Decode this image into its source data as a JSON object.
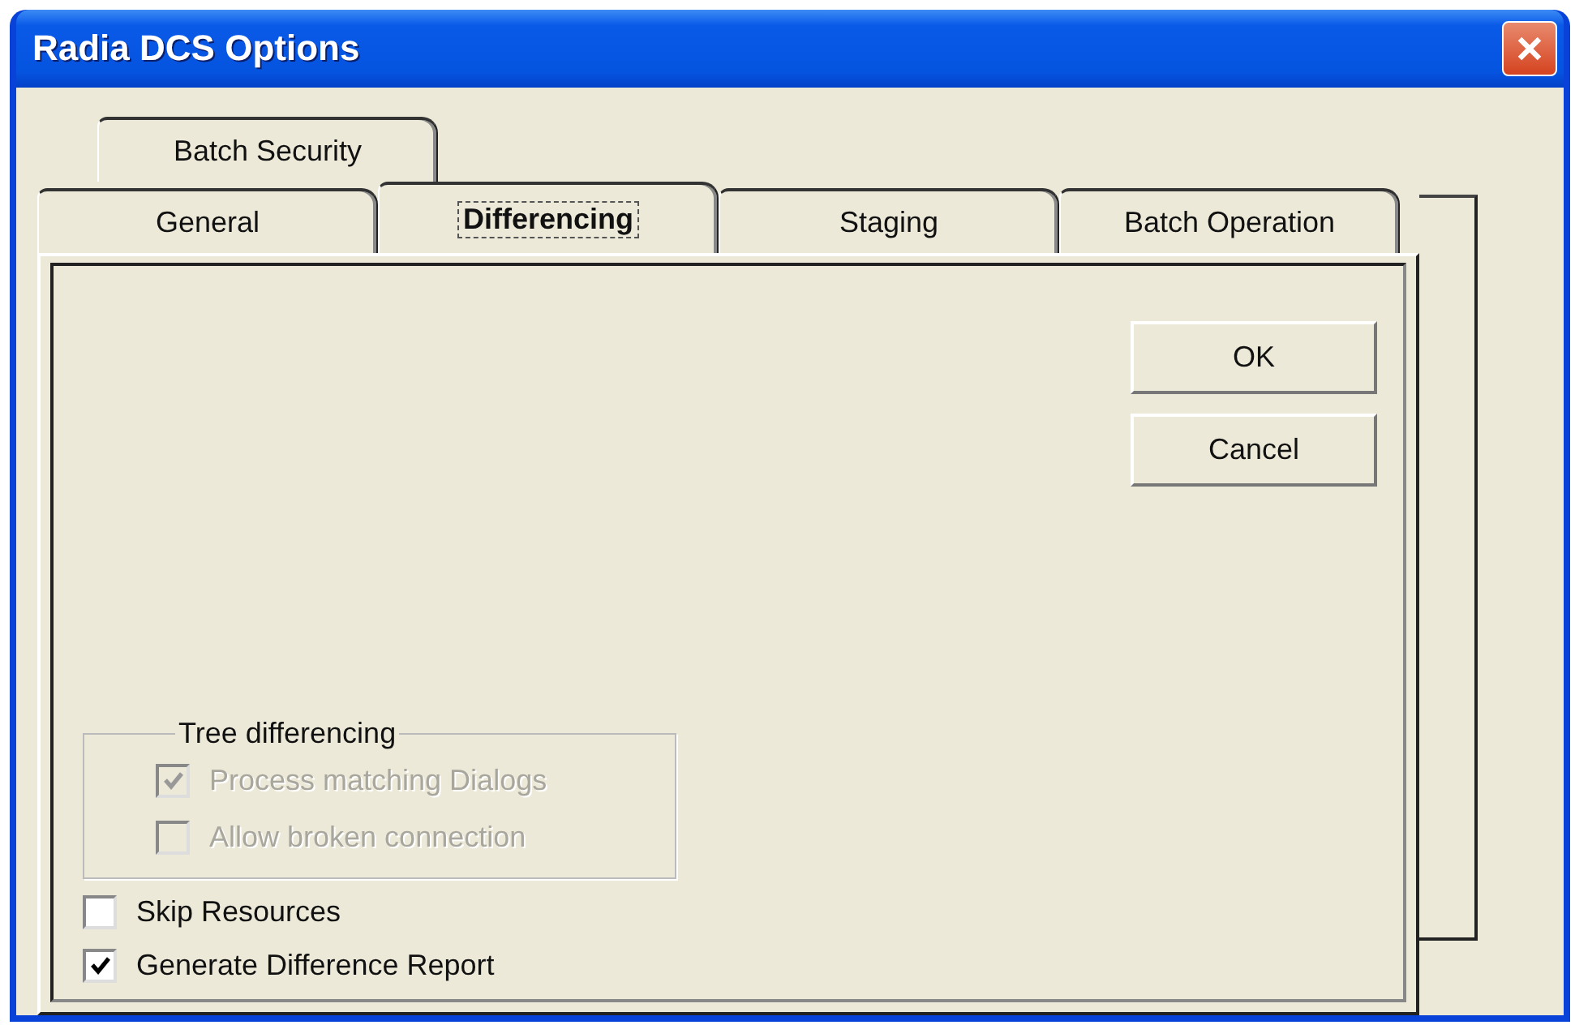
{
  "window": {
    "title": "Radia DCS Options"
  },
  "tab_rows": [
    [
      {
        "label": "Batch Security",
        "selected": false
      }
    ],
    [
      {
        "label": "General",
        "selected": false
      },
      {
        "label": "Differencing",
        "selected": true
      },
      {
        "label": "Staging",
        "selected": false
      },
      {
        "label": "Batch Operation",
        "selected": false
      }
    ]
  ],
  "buttons": [
    "OK",
    "Cancel"
  ],
  "group": {
    "title": "Tree differencing",
    "checkboxes": [
      {
        "label": "Process matching Dialogs",
        "checked": true,
        "disabled": true
      },
      {
        "label": "Allow broken connection",
        "checked": false,
        "disabled": true
      }
    ]
  },
  "checkboxes": [
    {
      "label": "Skip Resources",
      "checked": false,
      "disabled": false
    },
    {
      "label": "Generate Difference Report",
      "checked": true,
      "disabled": false
    }
  ]
}
